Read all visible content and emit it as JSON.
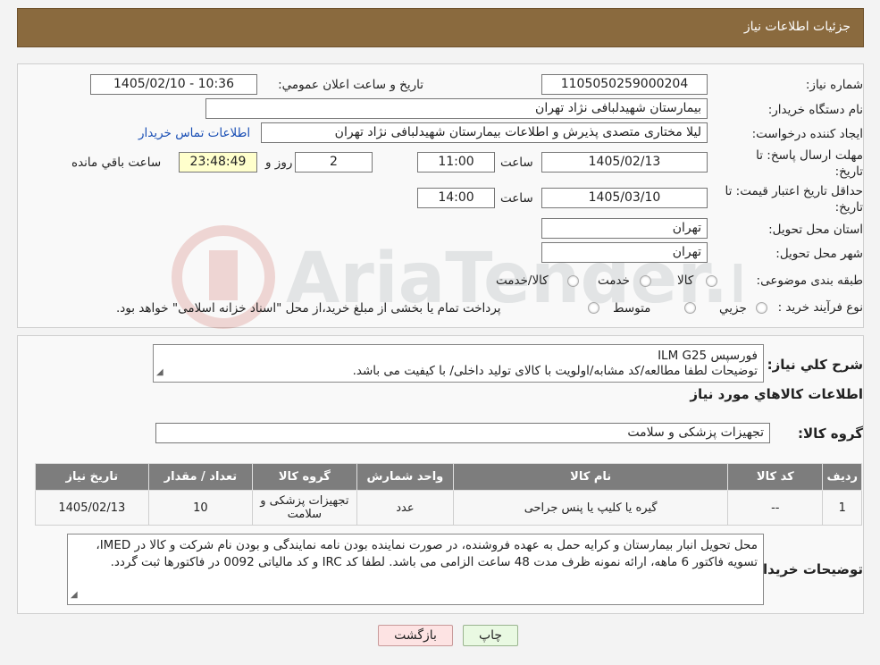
{
  "header": {
    "title": "جزئیات اطلاعات نیاز"
  },
  "fields": {
    "need_number_label": "شماره نیاز:",
    "need_number": "1105050259000204",
    "announce_label": "تاریخ و ساعت اعلان عمومي:",
    "announce_value": "1405/02/10 - 10:36",
    "buyer_org_label": "نام دستگاه خريدار:",
    "buyer_org": "بیمارستان شهیدلبافی نژاد تهران",
    "requester_label": "ایجاد کننده درخواست:",
    "requester": "لیلا مختاری متصدی پذیرش و اطلاعات بیمارستان شهیدلبافی نژاد تهران",
    "contact_link": "اطلاعات تماس خریدار",
    "deadline_label_1": "مهلت ارسال پاسخ: تا",
    "deadline_label_2": "تاریخ:",
    "deadline_date": "1405/02/13",
    "hour_label": "ساعت",
    "deadline_time": "11:00",
    "days_value": "2",
    "days_label": "روز و",
    "remaining_value": "23:48:49",
    "remaining_label": "ساعت باقي مانده",
    "validity_label_1": "حداقل تاريخ اعتبار قيمت: تا",
    "validity_label_2": "تاريخ:",
    "validity_date": "1405/03/10",
    "validity_hour_label": "ساعت",
    "validity_time": "14:00",
    "province_label": "استان محل تحويل:",
    "province": "تهران",
    "city_label": "شهر محل تحويل:",
    "city": "تهران",
    "category_label": "طبقه بندی موضوعی:",
    "category_options": [
      "کالا",
      "خدمت",
      "کالا/خدمت"
    ],
    "process_label": "نوع فرآیند خرید :",
    "process_options": [
      "جزيي",
      "متوسط"
    ],
    "process_note": "پرداخت تمام یا بخشی از مبلغ خرید،از محل \"اسناد خزانه اسلامی\" خواهد بود."
  },
  "summary": {
    "label": "شرح کلي نياز:",
    "line1": "فورسپس ILM G25",
    "line2": "توضیحات لطفا مطالعه/کد مشابه/اولویت با کالای تولید داخلی/ با کیفیت می باشد.",
    "goods_info_title": "اطلاعات کالاهاي مورد نياز",
    "group_label": "گروه کالا:",
    "group_value": "تجهیزات پزشکی و سلامت"
  },
  "table": {
    "headers": [
      "رديف",
      "کد کالا",
      "نام کالا",
      "واحد شمارش",
      "گروه کالا",
      "تعداد / مقدار",
      "تاریخ نیاز"
    ],
    "rows": [
      [
        "1",
        "--",
        "گیره یا کلیپ یا پنس جراحی",
        "عدد",
        "تجهیزات پزشکی و سلامت",
        "10",
        "1405/02/13"
      ]
    ]
  },
  "buyer_notes": {
    "label": "توضیحات خریدار:",
    "text": "محل تحویل انبار بیمارستان و کرایه حمل به عهده فروشنده، در صورت نماینده بودن نامه نمایندگی و بودن نام شرکت و کالا در IMED، تسویه فاکتور 6 ماهه، ارائه نمونه ظرف مدت 48 ساعت الزامی می باشد. لطفا کد IRC و کد مالیاتی 0092 در فاکتورها ثبت گردد."
  },
  "buttons": {
    "print": "چاپ",
    "back": "بازگشت"
  },
  "watermark": {
    "text": "AriaTender.neT"
  },
  "colors": {
    "header_bg": "#8a6a3e",
    "table_header_bg": "#7d7d7d",
    "link": "#1a4fb5",
    "timer_bg": "#ffffcc"
  }
}
